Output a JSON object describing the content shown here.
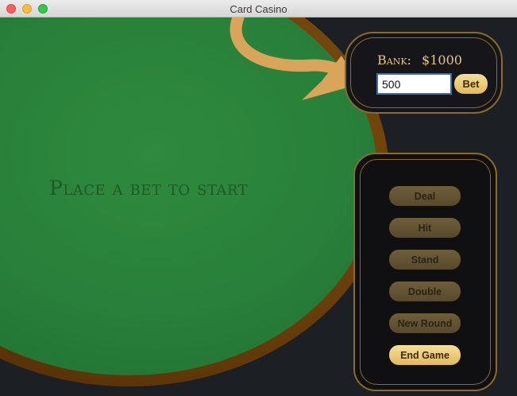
{
  "window": {
    "title": "Card Casino"
  },
  "table": {
    "message": "Place a bet to start"
  },
  "bank": {
    "label": "Bank:",
    "amount": "$1000",
    "bet_value": "500",
    "bet_button": "Bet"
  },
  "controls": {
    "deal": "Deal",
    "hit": "Hit",
    "stand": "Stand",
    "double": "Double",
    "new_round": "New Round",
    "end_game": "End Game"
  },
  "colors": {
    "felt": "#28803a",
    "rim": "#6b3f0b",
    "gold": "#e3c67d",
    "button_active": "#f0cf7a",
    "button_disabled": "#655434"
  },
  "icons": [
    "close-icon",
    "minimize-icon",
    "zoom-icon",
    "arrow-icon"
  ]
}
